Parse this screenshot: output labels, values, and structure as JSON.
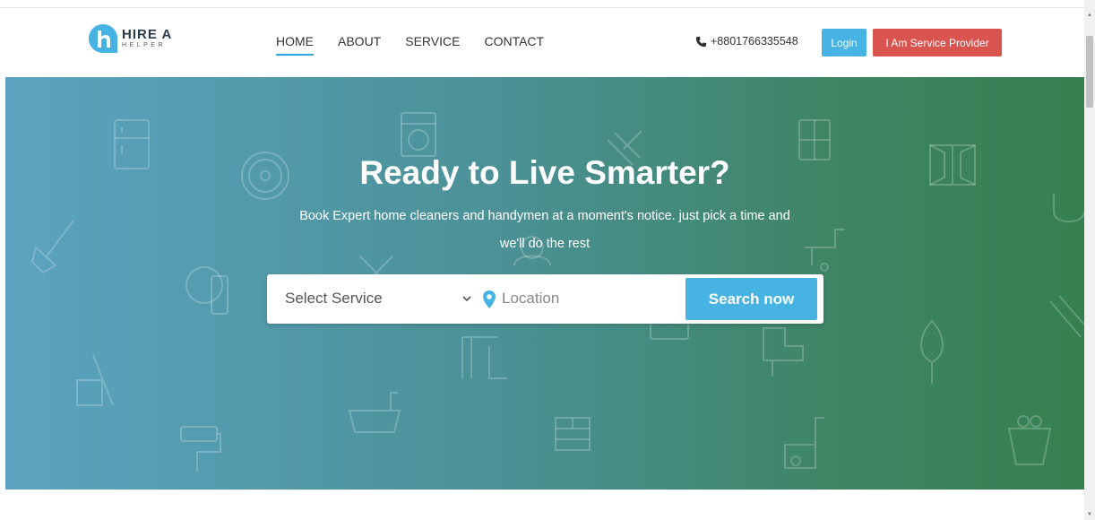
{
  "brand": {
    "name_main": "HIRE A",
    "name_sub": "HELPER",
    "logo_color": "#47b3e3"
  },
  "nav": {
    "items": [
      {
        "label": "HOME",
        "active": true
      },
      {
        "label": "ABOUT",
        "active": false
      },
      {
        "label": "SERVICE",
        "active": false
      },
      {
        "label": "CONTACT",
        "active": false
      }
    ]
  },
  "header": {
    "phone": "+8801766335548",
    "phone_icon": "phone-icon",
    "login_label": "Login",
    "provider_label": "I Am Service Provider"
  },
  "hero": {
    "title": "Ready to Live Smarter?",
    "subtitle": "Book Expert home cleaners and handymen at a moment's notice. just pick a time and we'll do the rest"
  },
  "search": {
    "service_selected": "Select Service",
    "location_placeholder": "Location",
    "location_value": "",
    "button_label": "Search now"
  },
  "colors": {
    "accent": "#47b3e3",
    "danger": "#d9534f",
    "hero_start": "#5ba3c0",
    "hero_end": "#36804f"
  }
}
